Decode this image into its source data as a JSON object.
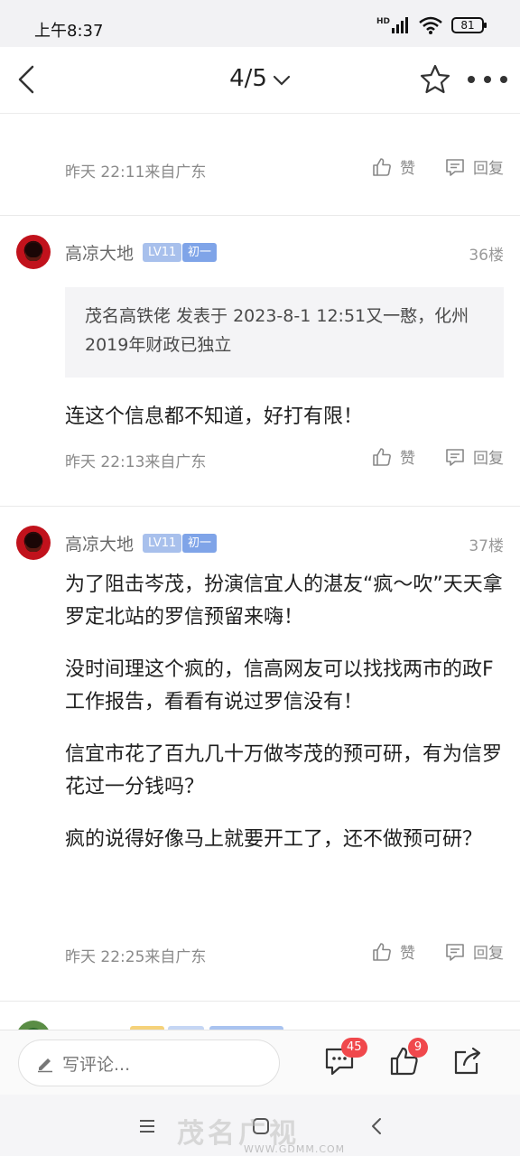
{
  "status_bar": {
    "time": "上午8:37",
    "network": "HD",
    "battery": "81"
  },
  "nav": {
    "page_indicator": "4/5"
  },
  "posts": [
    {
      "time_location": "昨天 22:11来自广东",
      "like_label": "赞",
      "reply_label": "回复"
    },
    {
      "username": "高凉大地",
      "level": "LV11",
      "rank": "初一",
      "floor": "36楼",
      "quote": "茂名高铁佬 发表于 2023-8-1 12:51又一憨，化州2019年财政已独立",
      "body": [
        "连这个信息都不知道，好打有限！"
      ],
      "time_location": "昨天 22:13来自广东",
      "like_label": "赞",
      "reply_label": "回复"
    },
    {
      "username": "高凉大地",
      "level": "LV11",
      "rank": "初一",
      "floor": "37楼",
      "body": [
        "为了阻击岑茂，扮演信宜人的湛友“疯～吹”天天拿罗定北站的罗信预留来嗨！",
        "没时间理这个疯的，信高网友可以找找两市的政F工作报告，看看有说过罗信没有！",
        "信宜市花了百九几十万做岑茂的预可研，有为信罗花过一分钱吗？",
        "疯的说得好像马上就要开工了，还不做预可研？"
      ],
      "time_location": "昨天 22:25来自广东",
      "like_label": "赞",
      "reply_label": "回复"
    }
  ],
  "bottom_bar": {
    "comment_placeholder": "写评论...",
    "comment_count": "45",
    "like_count": "9"
  },
  "watermark": {
    "text": "茂名广视",
    "url": "WWW.GDMM.COM"
  },
  "colors": {
    "badge_level": "#a8c0ec",
    "badge_rank": "#7fa4e8",
    "count_badge": "#f0484c"
  }
}
